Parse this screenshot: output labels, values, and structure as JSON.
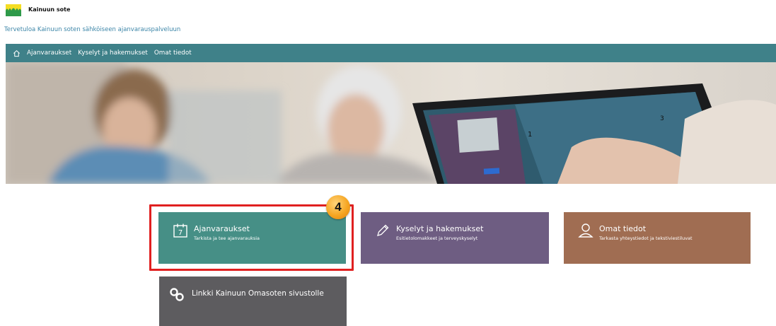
{
  "header": {
    "brand": "Kainuun sote",
    "welcome": "Tervetuloa Kainuun soten sähköiseen ajanvarauspalveluun"
  },
  "nav": {
    "home_icon": "home-icon",
    "items": [
      {
        "label": "Ajanvaraukset"
      },
      {
        "label": "Kyselyt ja hakemukset"
      },
      {
        "label": "Omat tiedot"
      }
    ]
  },
  "tiles": [
    {
      "title": "Ajanvaraukset",
      "subtitle": "Tarkista ja tee ajanvarauksia",
      "icon": "calendar-icon",
      "color": "#468f86"
    },
    {
      "title": "Kyselyt ja hakemukset",
      "subtitle": "Esitietolomakkeet ja terveyskyselyt",
      "icon": "pencil-icon",
      "color": "#6e5d82"
    },
    {
      "title": "Omat tiedot",
      "subtitle": "Tarkasta yhteystiedot ja tekstiviestiluvat",
      "icon": "user-icon",
      "color": "#a06d52"
    },
    {
      "title": "Linkki Kainuun Omasoten sivustolle",
      "icon": "link-icon",
      "color": "#5d5c5f"
    }
  ],
  "annotation": {
    "badge_number": "4",
    "highlight_color": "#e02020"
  },
  "calendar_day": "7",
  "colors": {
    "navbar": "#3f8189",
    "welcome_text": "#3d86a8"
  }
}
